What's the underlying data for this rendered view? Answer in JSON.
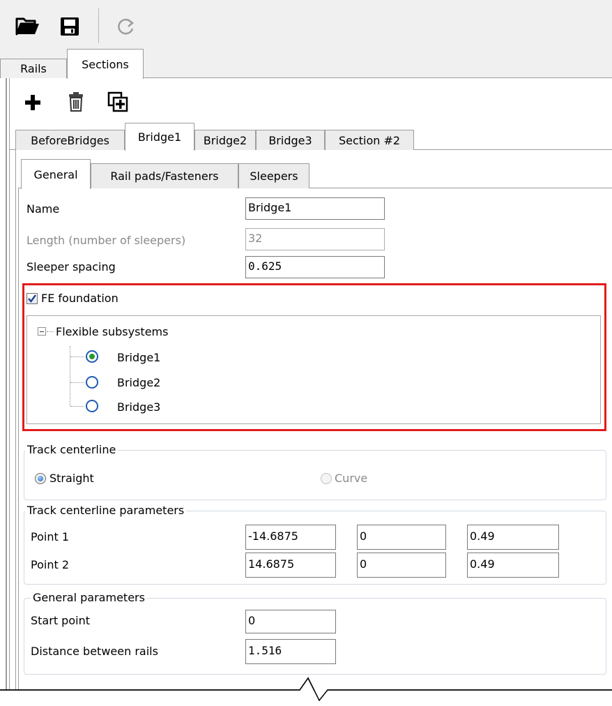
{
  "outer_tabs": [
    "Rails",
    "Sections"
  ],
  "section_tabs": [
    "BeforeBridges",
    "Bridge1",
    "Bridge2",
    "Bridge3",
    "Section #2"
  ],
  "inner_tabs": [
    "General",
    "Rail pads/Fasteners",
    "Sleepers"
  ],
  "general": {
    "name_label": "Name",
    "name_value": "Bridge1",
    "length_label": "Length (number of sleepers)",
    "length_value": "32",
    "spacing_label": "Sleeper spacing",
    "spacing_value": "0.625"
  },
  "fe_foundation": {
    "label": "FE foundation",
    "checked": true,
    "tree_root": "Flexible subsystems",
    "subsystems": [
      "Bridge1",
      "Bridge2",
      "Bridge3"
    ],
    "selected": "Bridge1"
  },
  "track_centerline": {
    "title": "Track centerline",
    "straight_label": "Straight",
    "curve_label": "Curve",
    "selected": "Straight"
  },
  "track_params": {
    "title": "Track centerline parameters",
    "point1_label": "Point 1",
    "point1": [
      "-14.6875",
      "0",
      "0.49"
    ],
    "point2_label": "Point 2",
    "point2": [
      "14.6875",
      "0",
      "0.49"
    ]
  },
  "general_params": {
    "title": "General parameters",
    "start_label": "Start point",
    "start_value": "0",
    "distance_label": "Distance between rails",
    "distance_value": "1.516"
  },
  "colors": {
    "highlight": "#e31b1b",
    "accent": "#1e5bb5"
  }
}
